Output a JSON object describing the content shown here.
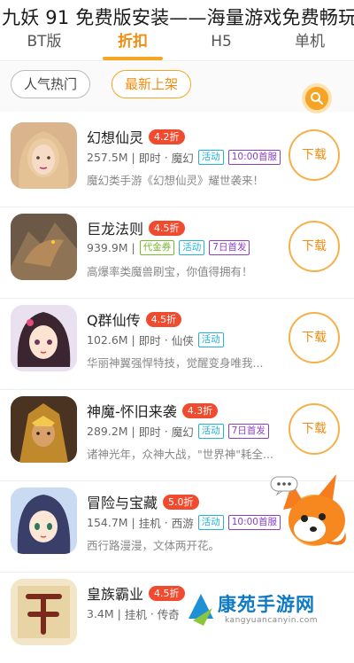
{
  "banner": {
    "title": "九妖 91 免费版安装——海量游戏免费畅玩"
  },
  "tabs": [
    {
      "label": "BT版"
    },
    {
      "label": "折扣"
    },
    {
      "label": "H5"
    },
    {
      "label": "单机"
    }
  ],
  "filters": {
    "popular": "人气热门",
    "newest": "最新上架"
  },
  "colors": {
    "accent": "#f5a623",
    "discount_badge": "#f04b2f",
    "tag_activity": "#21b2d8",
    "tag_first": "#8a3fc4"
  },
  "download_label": "下载",
  "games": [
    {
      "name": "幻想仙灵",
      "discount": "4.2折",
      "size": "257.5M",
      "mode": "即时",
      "genre": "魔幻",
      "tags": [
        "活动",
        "10:00首服"
      ],
      "desc": "魔幻类手游《幻想仙灵》耀世袭来！"
    },
    {
      "name": "巨龙法则",
      "discount": "4.5折",
      "size": "939.9M",
      "tags": [
        "代金券",
        "活动",
        "7日首发"
      ],
      "desc": "高爆率类魔兽刷宝，你值得拥有！"
    },
    {
      "name": "Q群仙传",
      "discount": "4.5折",
      "size": "102.6M",
      "mode": "即时",
      "genre": "仙侠",
      "tags": [
        "活动"
      ],
      "desc": "华丽神翼强悍特技，觉醒变身唯我..."
    },
    {
      "name": "神魔-怀旧来袭",
      "discount": "4.3折",
      "size": "289.2M",
      "mode": "即时",
      "genre": "魔幻",
      "tags": [
        "活动",
        "7日首发"
      ],
      "desc": "诸神光年，众神大战，\"世界神\"耗全..."
    },
    {
      "name": "冒险与宝藏",
      "discount": "5.0折",
      "size": "154.7M",
      "mode": "挂机",
      "genre": "西游",
      "tags": [
        "活动",
        "10:00首服"
      ],
      "desc": "西行路漫漫，文体两开花。"
    },
    {
      "name": "皇族霸业",
      "discount": "4.5折",
      "size": "3.4M",
      "mode": "挂机",
      "genre": "传奇",
      "tags": [],
      "desc": ""
    }
  ],
  "watermark": {
    "title": "康苑手游网",
    "subtitle": "kangyuancanyin.com"
  }
}
